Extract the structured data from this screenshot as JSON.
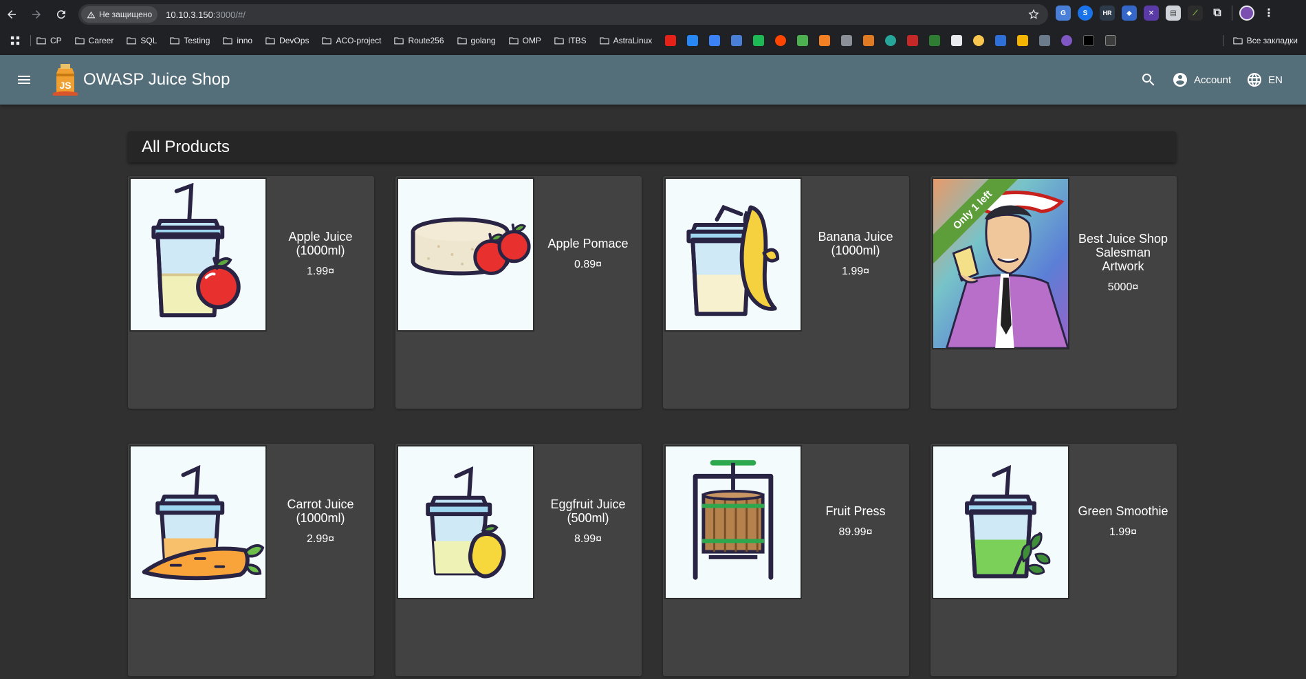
{
  "browser": {
    "security_label": "Не защищено",
    "url_host": "10.10.3.150",
    "url_rest": ":3000/#/",
    "bookmarks": [
      "CP",
      "Career",
      "SQL",
      "Testing",
      "inno",
      "DevOps",
      "ACO-project",
      "Route256",
      "golang",
      "OMP",
      "ITBS",
      "AstraLinux"
    ],
    "all_bookmarks_label": "Все закладки",
    "ext_hr_label": "HR"
  },
  "app": {
    "title": "OWASP Juice Shop",
    "account_label": "Account",
    "language_label": "EN",
    "logo_letters": "JS"
  },
  "main": {
    "heading": "All Products",
    "products": [
      {
        "name": "Apple Juice (1000ml)",
        "price": "1.99¤",
        "image": "apple-juice"
      },
      {
        "name": "Apple Pomace",
        "price": "0.89¤",
        "image": "apple-pomace"
      },
      {
        "name": "Banana Juice (1000ml)",
        "price": "1.99¤",
        "image": "banana-juice"
      },
      {
        "name": "Best Juice Shop Salesman Artwork",
        "price": "5000¤",
        "image": "salesman-artwork",
        "ribbon": "Only 1 left"
      },
      {
        "name": "Carrot Juice (1000ml)",
        "price": "2.99¤",
        "image": "carrot-juice"
      },
      {
        "name": "Eggfruit Juice (500ml)",
        "price": "8.99¤",
        "image": "eggfruit-juice"
      },
      {
        "name": "Fruit Press",
        "price": "89.99¤",
        "image": "fruit-press"
      },
      {
        "name": "Green Smoothie",
        "price": "1.99¤",
        "image": "green-smoothie"
      }
    ]
  },
  "colors": {
    "toolbar": "#546e7a",
    "background": "#303030",
    "card": "#424242",
    "ribbon": "#5e9e3a"
  }
}
